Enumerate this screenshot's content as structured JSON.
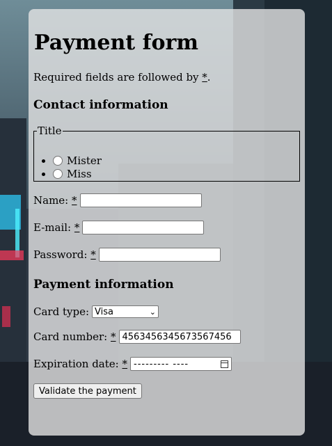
{
  "form": {
    "title": "Payment form",
    "required_note_prefix": "Required fields are followed by ",
    "required_star": "*",
    "required_note_suffix": ".",
    "contact_heading": "Contact information",
    "title_legend": "Title",
    "title_options": [
      "Mister",
      "Miss"
    ],
    "name_label": "Name:",
    "email_label": "E-mail:",
    "password_label": "Password:",
    "name_value": "",
    "email_value": "",
    "password_value": "",
    "payment_heading": "Payment information",
    "card_type_label": "Card type:",
    "card_type_selected": "Visa",
    "card_number_label": "Card number:",
    "card_number_value": "4563456345673567456",
    "expiration_label": "Expiration date:",
    "expiration_placeholder": "--------- ----",
    "submit_label": "Validate the payment"
  }
}
